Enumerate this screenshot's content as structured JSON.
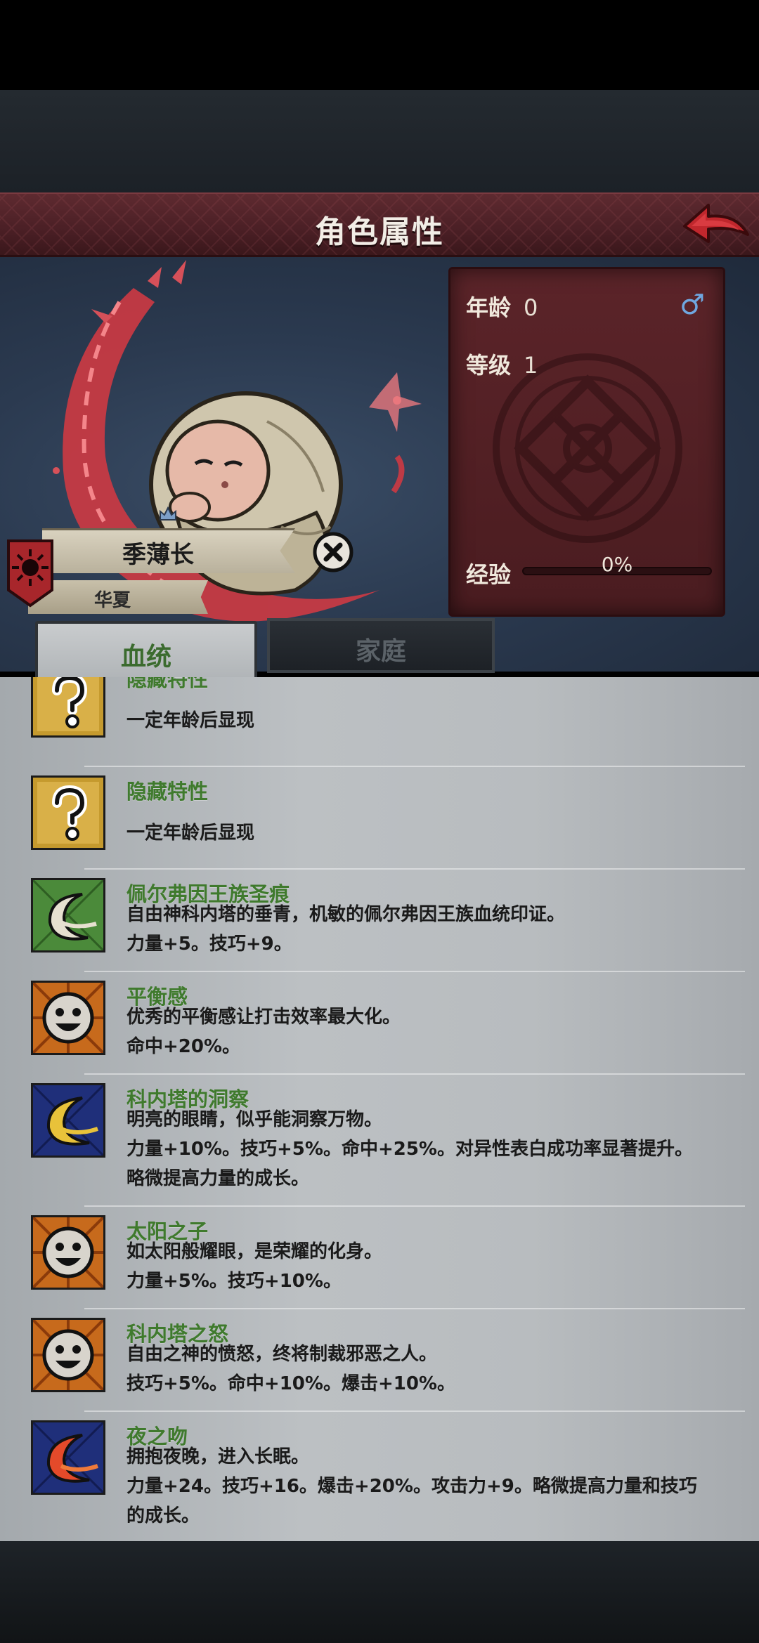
{
  "header": {
    "title": "角色属性"
  },
  "stats": {
    "age_label": "年龄",
    "age_value": "0",
    "level_label": "等级",
    "level_value": "1",
    "gender_symbol": "♂",
    "exp_label": "经验",
    "exp_percent_text": "0%",
    "exp_fraction": 0
  },
  "character": {
    "name": "季薄长",
    "origin": "华夏"
  },
  "tabs": [
    {
      "label": "血统",
      "active": true
    },
    {
      "label": "家庭",
      "active": false
    }
  ],
  "traits": [
    {
      "name": "隐藏特性",
      "icon": "question-mark-icon",
      "desc": [
        "一定年龄后显现"
      ]
    },
    {
      "name": "隐藏特性",
      "icon": "question-mark-icon",
      "desc": [
        "一定年龄后显现"
      ]
    },
    {
      "name": "佩尔弗因王族圣痕",
      "icon": "crescent-moon-white-icon",
      "desc": [
        "自由神科内塔的垂青，机敏的佩尔弗因王族血统印证。",
        "力量+5。技巧+9。"
      ]
    },
    {
      "name": "平衡感",
      "icon": "smiley-face-icon",
      "desc": [
        "优秀的平衡感让打击效率最大化。",
        "命中+20%。"
      ]
    },
    {
      "name": "科内塔的洞察",
      "icon": "crescent-moon-gold-icon",
      "desc": [
        "明亮的眼睛，似乎能洞察万物。",
        "力量+10%。技巧+5%。命中+25%。对异性表白成功率显著提升。",
        "略微提高力量的成长。"
      ]
    },
    {
      "name": "太阳之子",
      "icon": "smiley-face-icon",
      "desc": [
        "如太阳般耀眼，是荣耀的化身。",
        "力量+5%。技巧+10%。"
      ]
    },
    {
      "name": "科内塔之怒",
      "icon": "smiley-face-icon",
      "desc": [
        "自由之神的愤怒，终将制裁邪恶之人。",
        "技巧+5%。命中+10%。爆击+10%。"
      ]
    },
    {
      "name": "夜之吻",
      "icon": "crescent-moon-red-icon",
      "desc": [
        "拥抱夜晚，进入长眠。",
        "力量+24。技巧+16。爆击+20%。攻击力+9。略微提高力量和技巧",
        "的成长。"
      ]
    }
  ],
  "colors": {
    "header_bg": "#4a1f25",
    "trait_name": "#3f7a2d",
    "tab_active_text": "#3b6b2e",
    "gender_blue": "#6fa7e0"
  }
}
